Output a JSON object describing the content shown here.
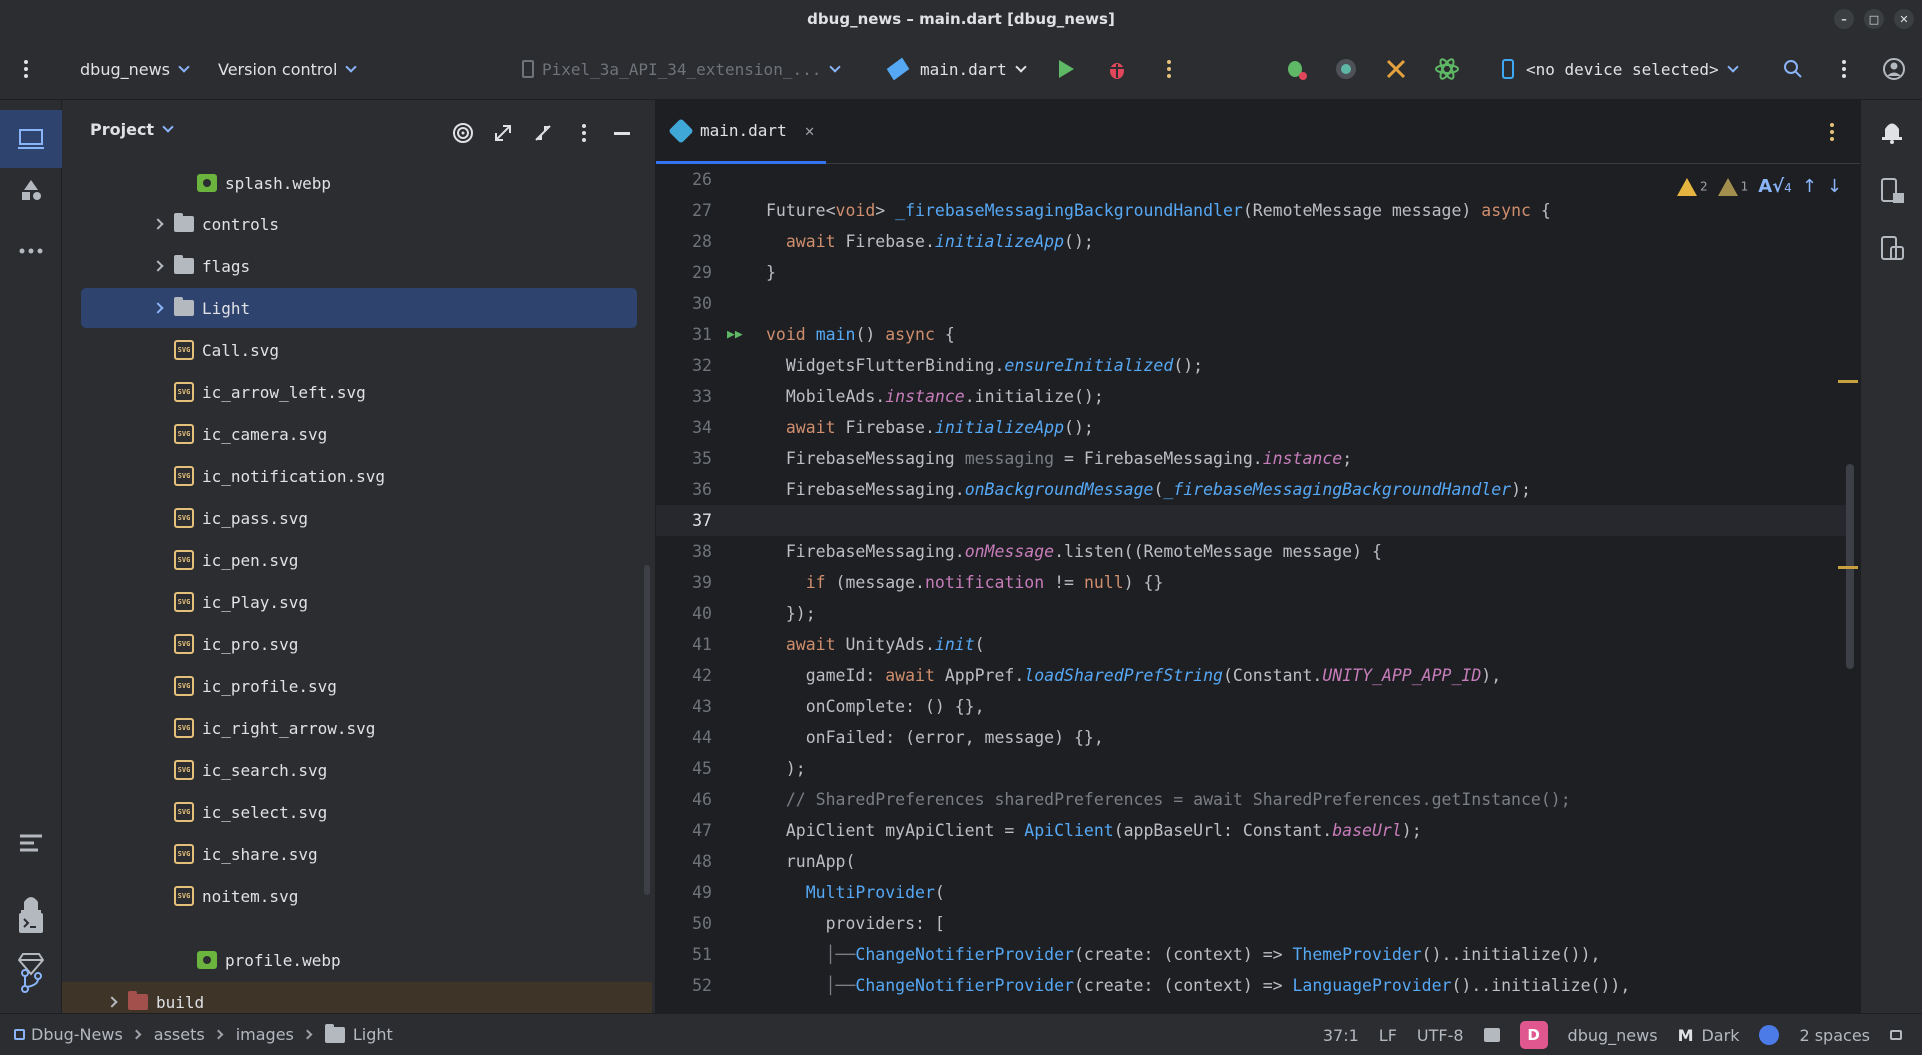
{
  "window": {
    "title": "dbug_news – main.dart [dbug_news]"
  },
  "toolbar": {
    "project_name": "dbug_news",
    "vcs_label": "Version control",
    "device_config": "Pixel_3a_API_34_extension_...",
    "run_config": "main.dart",
    "device_selector": "<no device selected>"
  },
  "project_panel": {
    "title": "Project",
    "items": [
      {
        "label": "splash.webp",
        "kind": "webp"
      },
      {
        "label": "controls",
        "kind": "folder"
      },
      {
        "label": "flags",
        "kind": "folder"
      },
      {
        "label": "Light",
        "kind": "folder"
      },
      {
        "label": "Call.svg",
        "kind": "svg"
      },
      {
        "label": "ic_arrow_left.svg",
        "kind": "svg"
      },
      {
        "label": "ic_camera.svg",
        "kind": "svg"
      },
      {
        "label": "ic_notification.svg",
        "kind": "svg"
      },
      {
        "label": "ic_pass.svg",
        "kind": "svg"
      },
      {
        "label": "ic_pen.svg",
        "kind": "svg"
      },
      {
        "label": "ic_Play.svg",
        "kind": "svg"
      },
      {
        "label": "ic_pro.svg",
        "kind": "svg"
      },
      {
        "label": "ic_profile.svg",
        "kind": "svg"
      },
      {
        "label": "ic_right_arrow.svg",
        "kind": "svg"
      },
      {
        "label": "ic_search.svg",
        "kind": "svg"
      },
      {
        "label": "ic_select.svg",
        "kind": "svg"
      },
      {
        "label": "ic_share.svg",
        "kind": "svg"
      },
      {
        "label": "noitem.svg",
        "kind": "svg"
      },
      {
        "label": "profile.webp",
        "kind": "webp"
      },
      {
        "label": "build",
        "kind": "build-folder"
      }
    ],
    "svg_badge": "SVG"
  },
  "editor": {
    "tab_label": "main.dart",
    "inspections": {
      "warnings": "2",
      "weak_warnings": "1",
      "typos": "4"
    },
    "line_numbers": [
      "26",
      "27",
      "28",
      "29",
      "30",
      "31",
      "32",
      "33",
      "34",
      "35",
      "36",
      "37",
      "38",
      "39",
      "40",
      "41",
      "42",
      "43",
      "44",
      "45",
      "46",
      "47",
      "48",
      "49",
      "50",
      "51",
      "52"
    ],
    "code": {
      "l27a": "Future<",
      "l27b": "void",
      "l27c": "> ",
      "l27d": "_firebaseMessagingBackgroundHandler",
      "l27e": "(RemoteMessage message) ",
      "l27f": "async",
      "l27g": " {",
      "l28a": "  ",
      "l28b": "await",
      "l28c": " Firebase.",
      "l28d": "initializeApp",
      "l28e": "();",
      "l29": "}",
      "l31a": "void",
      "l31b": " ",
      "l31c": "main",
      "l31d": "() ",
      "l31e": "async",
      "l31f": " {",
      "l32a": "  WidgetsFlutterBinding.",
      "l32b": "ensureInitialized",
      "l32c": "();",
      "l33a": "  MobileAds.",
      "l33b": "instance",
      "l33c": ".initialize();",
      "l34a": "  ",
      "l34b": "await",
      "l34c": " Firebase.",
      "l34d": "initializeApp",
      "l34e": "();",
      "l35a": "  FirebaseMessaging ",
      "l35b": "messaging",
      "l35c": " = FirebaseMessaging.",
      "l35d": "instance",
      "l35e": ";",
      "l36a": "  FirebaseMessaging.",
      "l36b": "onBackgroundMessage",
      "l36c": "(",
      "l36d": "_firebaseMessagingBackgroundHandler",
      "l36e": ");",
      "l38a": "  FirebaseMessaging.",
      "l38b": "onMessage",
      "l38c": ".listen((RemoteMessage message) {",
      "l39a": "    ",
      "l39b": "if",
      "l39c": " (message.",
      "l39d": "notification",
      "l39e": " != ",
      "l39f": "null",
      "l39g": ") {}",
      "l40": "  });",
      "l41a": "  ",
      "l41b": "await",
      "l41c": " UnityAds.",
      "l41d": "init",
      "l41e": "(",
      "l42a": "    gameId: ",
      "l42b": "await",
      "l42c": " AppPref.",
      "l42d": "loadSharedPrefString",
      "l42e": "(Constant.",
      "l42f": "UNITY_APP_APP_ID",
      "l42g": "),",
      "l43": "    onComplete: () {},",
      "l44": "    onFailed: (error, message) {},",
      "l45": "  );",
      "l46": "  // SharedPreferences sharedPreferences = await SharedPreferences.getInstance();",
      "l47a": "  ApiClient myApiClient = ",
      "l47b": "ApiClient",
      "l47c": "(appBaseUrl: Constant.",
      "l47d": "baseUrl",
      "l47e": ");",
      "l48": "  runApp(",
      "l49a": "    ",
      "l49b": "MultiProvider",
      "l49c": "(",
      "l50": "      providers: [",
      "l51a": "      │──",
      "l51b": "ChangeNotifierProvider",
      "l51c": "(create: (context) => ",
      "l51d": "ThemeProvider",
      "l51e": "()..initialize()),",
      "l52a": "      │──",
      "l52b": "ChangeNotifierProvider",
      "l52c": "(create: (context) => ",
      "l52d": "LanguageProvider",
      "l52e": "()..initialize()),"
    }
  },
  "status_bar": {
    "breadcrumbs": [
      "Dbug-News",
      "assets",
      "images",
      "Light"
    ],
    "caret": "37:1",
    "line_sep": "LF",
    "encoding": "UTF-8",
    "avatar_letter": "D",
    "project": "dbug_news",
    "theme": "Dark",
    "indent": "2 spaces"
  },
  "colors": {
    "accent": "#3574f0",
    "selection": "#2e436e",
    "warning": "#e5b540",
    "run": "#5fb865",
    "debug": "#e0475b"
  }
}
